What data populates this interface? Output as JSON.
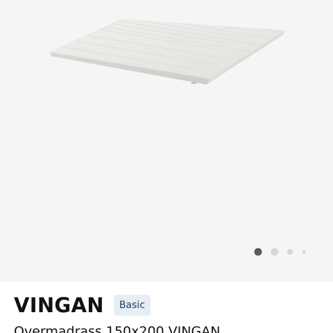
{
  "gallery": {
    "image_icon": "mattress-topper-image",
    "background_color": "#f5f5f5",
    "pager": {
      "total": 4,
      "active_index": 1,
      "active_color": "#5a5a5a",
      "inactive_color": "#d6d6d6"
    }
  },
  "product": {
    "name": "VINGAN",
    "badge": "Basic",
    "description": "Overmadrass 150x200 VINGAN"
  },
  "colors": {
    "badge_background": "#e7edf4",
    "badge_text": "#1f3f66",
    "text": "#111111"
  }
}
